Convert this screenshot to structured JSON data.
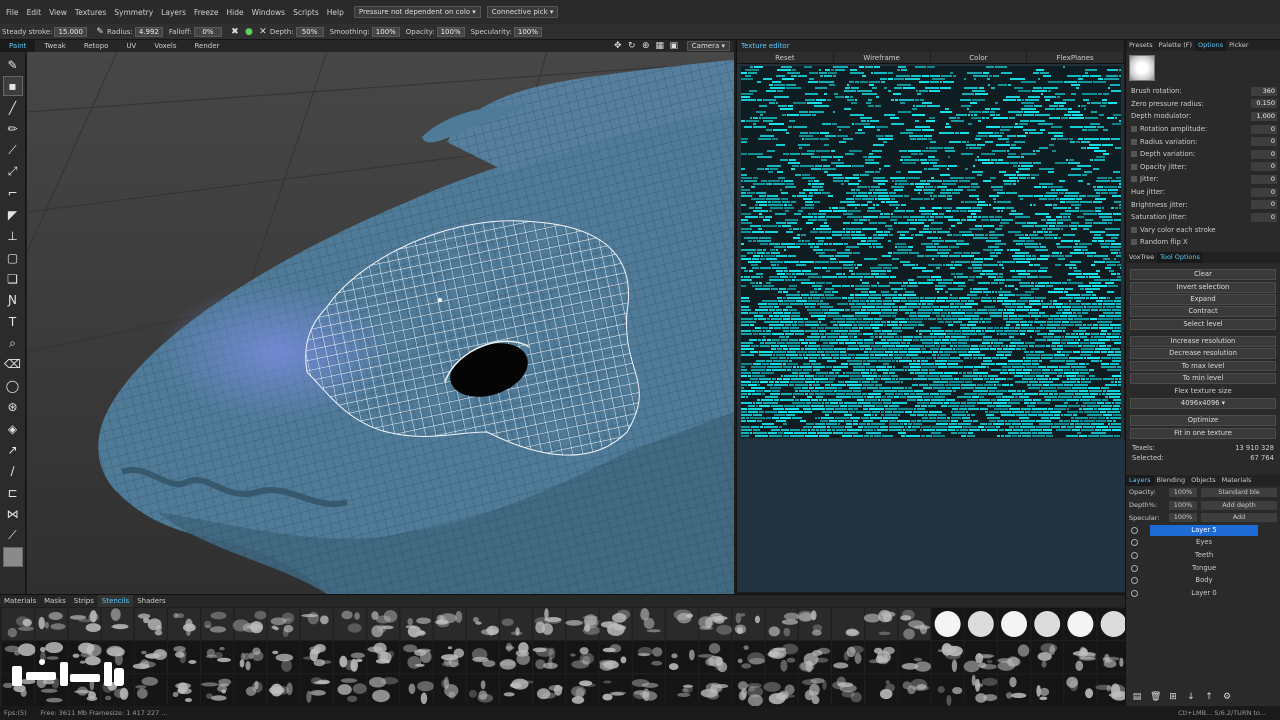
{
  "menu": {
    "items": [
      "File",
      "Edit",
      "View",
      "Textures",
      "Symmetry",
      "Layers",
      "Freeze",
      "Hide",
      "Windows",
      "Scripts",
      "Help"
    ],
    "pressure_combo": "Pressure not dependent on colo",
    "connective_combo": "Connective pick"
  },
  "params": {
    "stroke_label": "Steady stroke:",
    "stroke_value": "15.000",
    "radius_label": "Radius:",
    "radius_value": "4.992",
    "falloff_label": "Falloff:",
    "falloff_value": "0%",
    "depth_label": "Depth:",
    "depth_value": "50%",
    "smoothing_label": "Smoothing:",
    "smoothing_value": "100%",
    "opacity_label": "Opacity:",
    "opacity_value": "100%",
    "specularity_label": "Specularity:",
    "specularity_value": "100%",
    "camera_combo": "Camera"
  },
  "rooms": [
    "Paint",
    "Tweak",
    "Retopo",
    "UV",
    "Voxels",
    "Render"
  ],
  "active_room": "Paint",
  "texture_editor": {
    "title": "Texture editor",
    "buttons": [
      "Reset",
      "Wireframe",
      "Color",
      "FlexPlanes"
    ]
  },
  "right_panel": {
    "tabs": [
      "Presets",
      "Palette (F)",
      "Options",
      "Picker"
    ],
    "active_tab": "Options",
    "options": [
      {
        "label": "Brush rotation:",
        "value": "360"
      },
      {
        "label": "Zero pressure radius:",
        "value": "0.150"
      },
      {
        "label": "Depth modulator:",
        "value": "1.000"
      },
      {
        "label": "Rotation amplitude:",
        "value": "0"
      },
      {
        "label": "Radius variation:",
        "value": "0"
      },
      {
        "label": "Depth variation:",
        "value": "0"
      },
      {
        "label": "Opacity jitter:",
        "value": "0"
      },
      {
        "label": "Jitter:",
        "value": "0"
      },
      {
        "label": "Hue jitter:",
        "value": "0"
      },
      {
        "label": "Brightness jitter:",
        "value": "0"
      },
      {
        "label": "Saturation jitter:",
        "value": "0"
      }
    ],
    "checks": [
      "Vary color each stroke",
      "Random flip X"
    ],
    "tabs2": [
      "VoxTree",
      "Tool Options"
    ],
    "actions_top": [
      "Clear",
      "Invert selection",
      "Expand",
      "Contract",
      "Select level"
    ],
    "actions_mid": [
      "Increase resolution",
      "Decrease resolution",
      "To max level",
      "To min level"
    ],
    "flex_label": "Flex texture size",
    "flex_combo": "4096x4096",
    "actions_bottom": [
      "Optimize",
      "Fit in one texture"
    ],
    "stats": [
      {
        "label": "Texels:",
        "value": "13 910 328"
      },
      {
        "label": "Selected:",
        "value": "67 764"
      }
    ],
    "layer_tabs": [
      "Layers",
      "Blending",
      "Objects",
      "Materials"
    ],
    "layer_params": [
      {
        "label": "Opacity:",
        "value": "100%",
        "combo": "Standard ble"
      },
      {
        "label": "Depth%:",
        "value": "100%",
        "combo": "Add depth"
      },
      {
        "label": "Specular:",
        "value": "100%",
        "combo": "Add"
      }
    ],
    "layers": [
      "Layer 5",
      "Eyes",
      "Teeth",
      "Tongue",
      "Body",
      "Layer 0"
    ],
    "active_layer": "Layer 5"
  },
  "shelf": {
    "tabs": [
      "Materials",
      "Masks",
      "Strips",
      "Stencils",
      "Shaders"
    ],
    "active_tab": "Stencils"
  },
  "status": {
    "fps": "Fps:(5)",
    "texture_info": "Free: 3611 Mb Framesize: 1 417 227 ...",
    "right_info": "Ctl+LMB...  S/6.2/TURN to..."
  },
  "colors": {
    "accent": "#59c9ff",
    "mesh": "#4f7b98",
    "texture": "#18e8f0",
    "selection": "#1f6bd6"
  }
}
